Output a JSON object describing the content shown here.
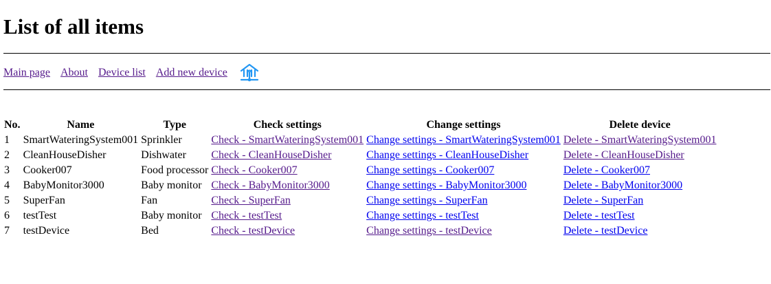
{
  "page": {
    "title": "List of all items"
  },
  "nav": {
    "links": [
      {
        "label": "Main page"
      },
      {
        "label": "About"
      },
      {
        "label": "Device list"
      },
      {
        "label": "Add new device"
      }
    ],
    "icon": "smart-home-icon",
    "icon_color": "#2196f3"
  },
  "colors": {
    "link_visited": "#551a8b",
    "link_unvisited": "#0000ee"
  },
  "table": {
    "headers": [
      "No.",
      "Name",
      "Type",
      "Check settings",
      "Change settings",
      "Delete device"
    ],
    "rows": [
      {
        "no": "1",
        "name": "SmartWateringSystem001",
        "type": "Sprinkler",
        "check": "Check - SmartWateringSystem001",
        "change": "Change settings - SmartWateringSystem001",
        "delete": "Delete - SmartWateringSystem001",
        "change_visited": false,
        "delete_visited": true
      },
      {
        "no": "2",
        "name": "CleanHouseDisher",
        "type": "Dishwater",
        "check": "Check - CleanHouseDisher",
        "change": "Change settings - CleanHouseDisher",
        "delete": "Delete - CleanHouseDisher",
        "change_visited": false,
        "delete_visited": true
      },
      {
        "no": "3",
        "name": "Cooker007",
        "type": "Food processor",
        "check": "Check - Cooker007",
        "change": "Change settings - Cooker007",
        "delete": "Delete - Cooker007",
        "change_visited": false,
        "delete_visited": false
      },
      {
        "no": "4",
        "name": "BabyMonitor3000",
        "type": "Baby monitor",
        "check": "Check - BabyMonitor3000",
        "change": "Change settings - BabyMonitor3000",
        "delete": "Delete - BabyMonitor3000",
        "change_visited": false,
        "delete_visited": false
      },
      {
        "no": "5",
        "name": "SuperFan",
        "type": "Fan",
        "check": "Check - SuperFan",
        "change": "Change settings - SuperFan",
        "delete": "Delete - SuperFan",
        "change_visited": false,
        "delete_visited": false
      },
      {
        "no": "6",
        "name": "testTest",
        "type": "Baby monitor",
        "check": "Check - testTest",
        "change": "Change settings - testTest",
        "delete": "Delete - testTest",
        "change_visited": false,
        "delete_visited": false
      },
      {
        "no": "7",
        "name": "testDevice",
        "type": "Bed",
        "check": "Check - testDevice",
        "change": "Change settings - testDevice",
        "delete": "Delete - testDevice",
        "change_visited": true,
        "delete_visited": false
      }
    ]
  }
}
